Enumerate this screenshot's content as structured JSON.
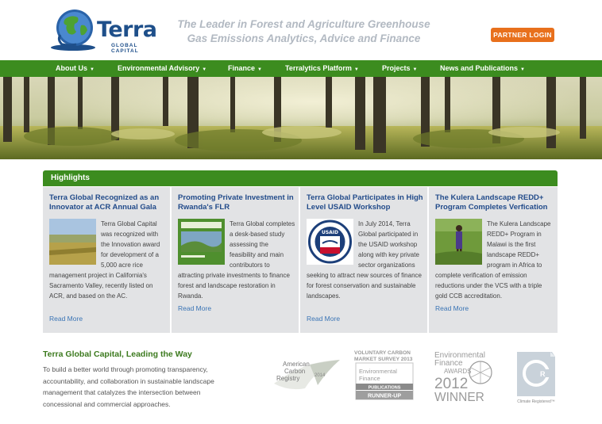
{
  "header": {
    "logo_name": "Terra",
    "logo_sub": "GLOBAL CAPITAL",
    "tagline_line1": "The Leader in Forest and Agriculture Greenhouse",
    "tagline_line2": "Gas Emissions Analytics, Advice and Finance",
    "partner_login": "PARTNER LOGIN"
  },
  "colors": {
    "brand_green": "#3c8c1f",
    "brand_blue": "#1e4f8a",
    "accent_orange": "#e8701c",
    "link_blue": "#3a74b5"
  },
  "nav": {
    "items": [
      {
        "label": "About Us"
      },
      {
        "label": "Environmental Advisory"
      },
      {
        "label": "Finance"
      },
      {
        "label": "Terralytics Platform"
      },
      {
        "label": "Projects"
      },
      {
        "label": "News and Publications"
      }
    ]
  },
  "highlights": {
    "heading": "Highlights",
    "cards": [
      {
        "title": "Terra Global Recognized as an Innovator at ACR Annual Gala",
        "body": "Terra Global Capital was recognized with the Innovation award for development of a 5,000 acre rice management project in California's Sacramento Valley, recently listed on ACR, and based on the AC.",
        "read_more": "Read More",
        "thumb_icon": "rice-field-photo"
      },
      {
        "title": "Promoting Private Investment in Rwanda's FLR",
        "body": "Terra Global completes a desk-based study assessing the feasibility and main contributors to attracting private investments to finance forest and landscape restoration in Rwanda.",
        "read_more": "Read More",
        "thumb_icon": "report-cover-photo"
      },
      {
        "title": "Terra Global Participates in High Level USAID Workshop",
        "body": "In July 2014, Terra Global participated in the USAID workshop along with key private sector organizations seeking to attract new sources of finance for forest conservation and sustainable landscapes.",
        "read_more": "Read More",
        "thumb_icon": "usaid-seal",
        "seal_text": "USAID"
      },
      {
        "title": "The Kulera Landscape REDD+ Program Completes Verfication",
        "body": "The Kulera Landscape REDD+ Program in Malawi is the first landscape REDD+ program in Africa to complete verification of emission reductions under the VCS with a triple gold CCB accreditation.",
        "read_more": "Read More",
        "thumb_icon": "farmer-photo"
      }
    ]
  },
  "about": {
    "title": "Terra Global Capital, Leading the Way",
    "text": "To build a better world through promoting transparency, accountability, and collaboration in sustainable landscape management that catalyzes the intersection between concessional and commercial approaches."
  },
  "awards": {
    "acr_line1": "American",
    "acr_line2": "Carbon",
    "acr_line3": "Registry",
    "acr_year": "2014",
    "vcm_line1": "VOLUNTARY CARBON",
    "vcm_line2": "MARKET SURVEY 2013",
    "vcm_line3": "Environmental",
    "vcm_line4": "Finance",
    "vcm_line5": "PUBLICATIONS",
    "vcm_line6": "RUNNER-UP",
    "ef_line1": "Environmental",
    "ef_line2": "Finance",
    "ef_line3": "AWARDS",
    "ef_line4": "2012",
    "ef_line5": "WINNER",
    "cr_label": "Climate Registered™"
  }
}
